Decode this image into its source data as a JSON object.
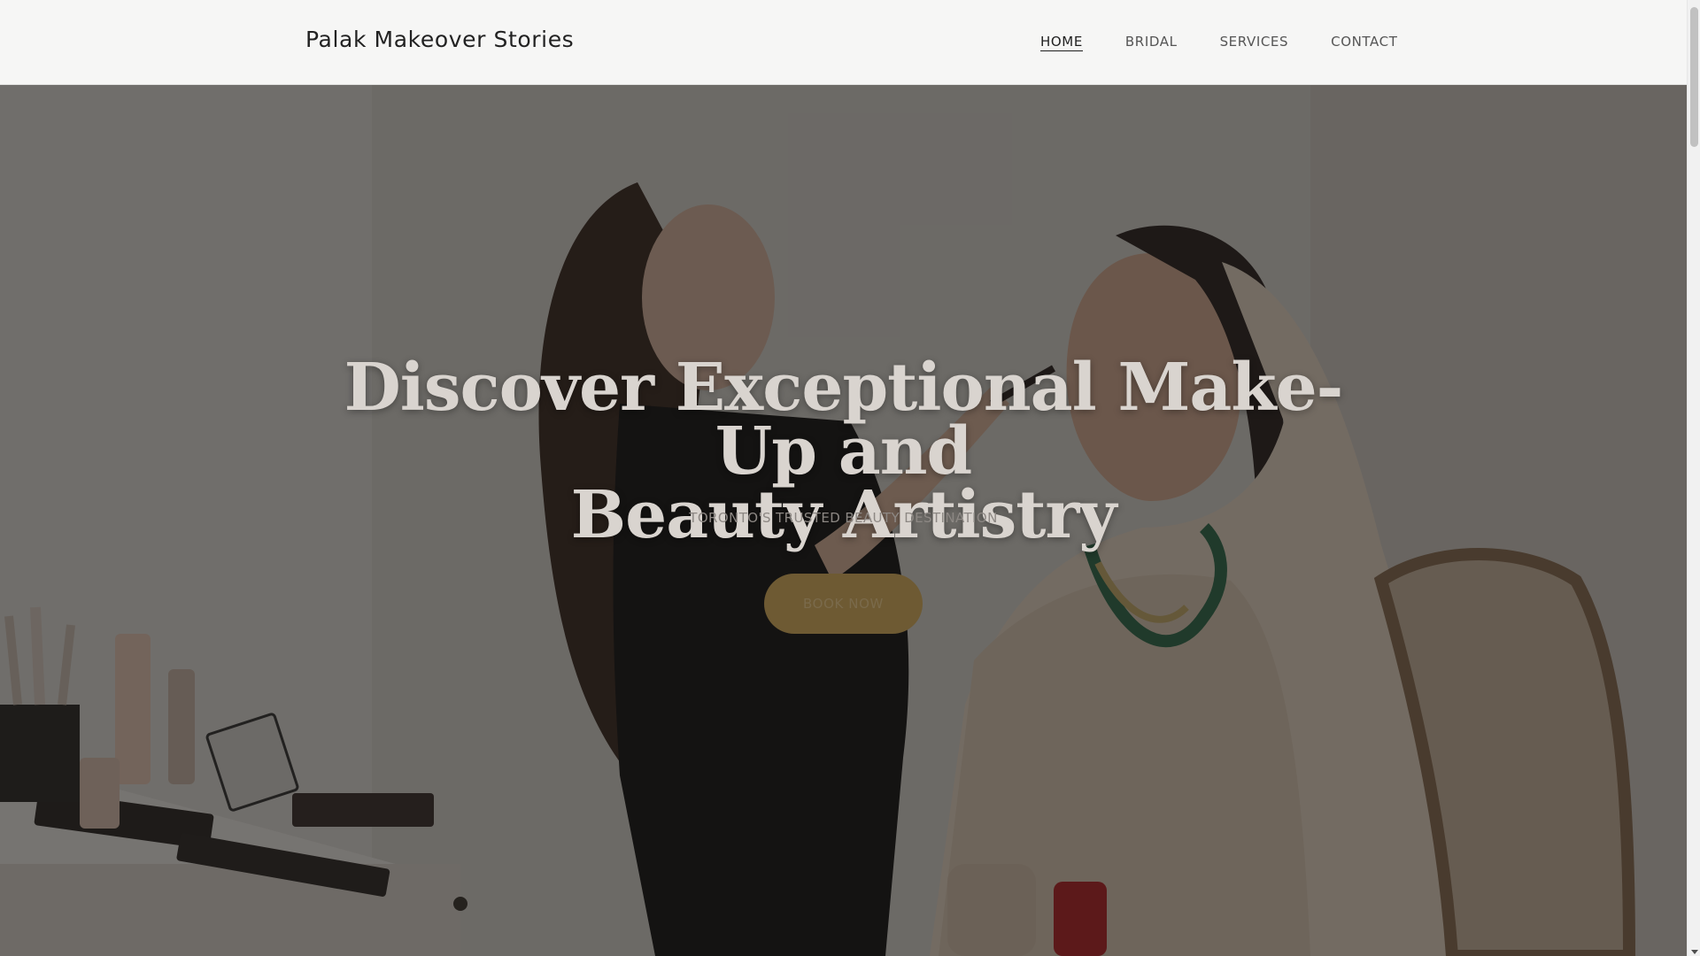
{
  "header": {
    "brand": "Palak Makeover Stories",
    "nav": [
      {
        "label": "HOME",
        "active": true
      },
      {
        "label": "BRIDAL",
        "active": false
      },
      {
        "label": "SERVICES",
        "active": false
      },
      {
        "label": "CONTACT",
        "active": false
      }
    ]
  },
  "hero": {
    "title_line1": "Discover Exceptional Make-Up and",
    "title_line2": "Beauty Artistry",
    "subtitle": "TORONTO'S TRUSTED BEAUTY DESTINATION",
    "cta_label": "BOOK NOW"
  },
  "colors": {
    "header_bg": "#f6f6f5",
    "cta_bg": "#6e5a33",
    "title_color": "#d9d4cf"
  }
}
